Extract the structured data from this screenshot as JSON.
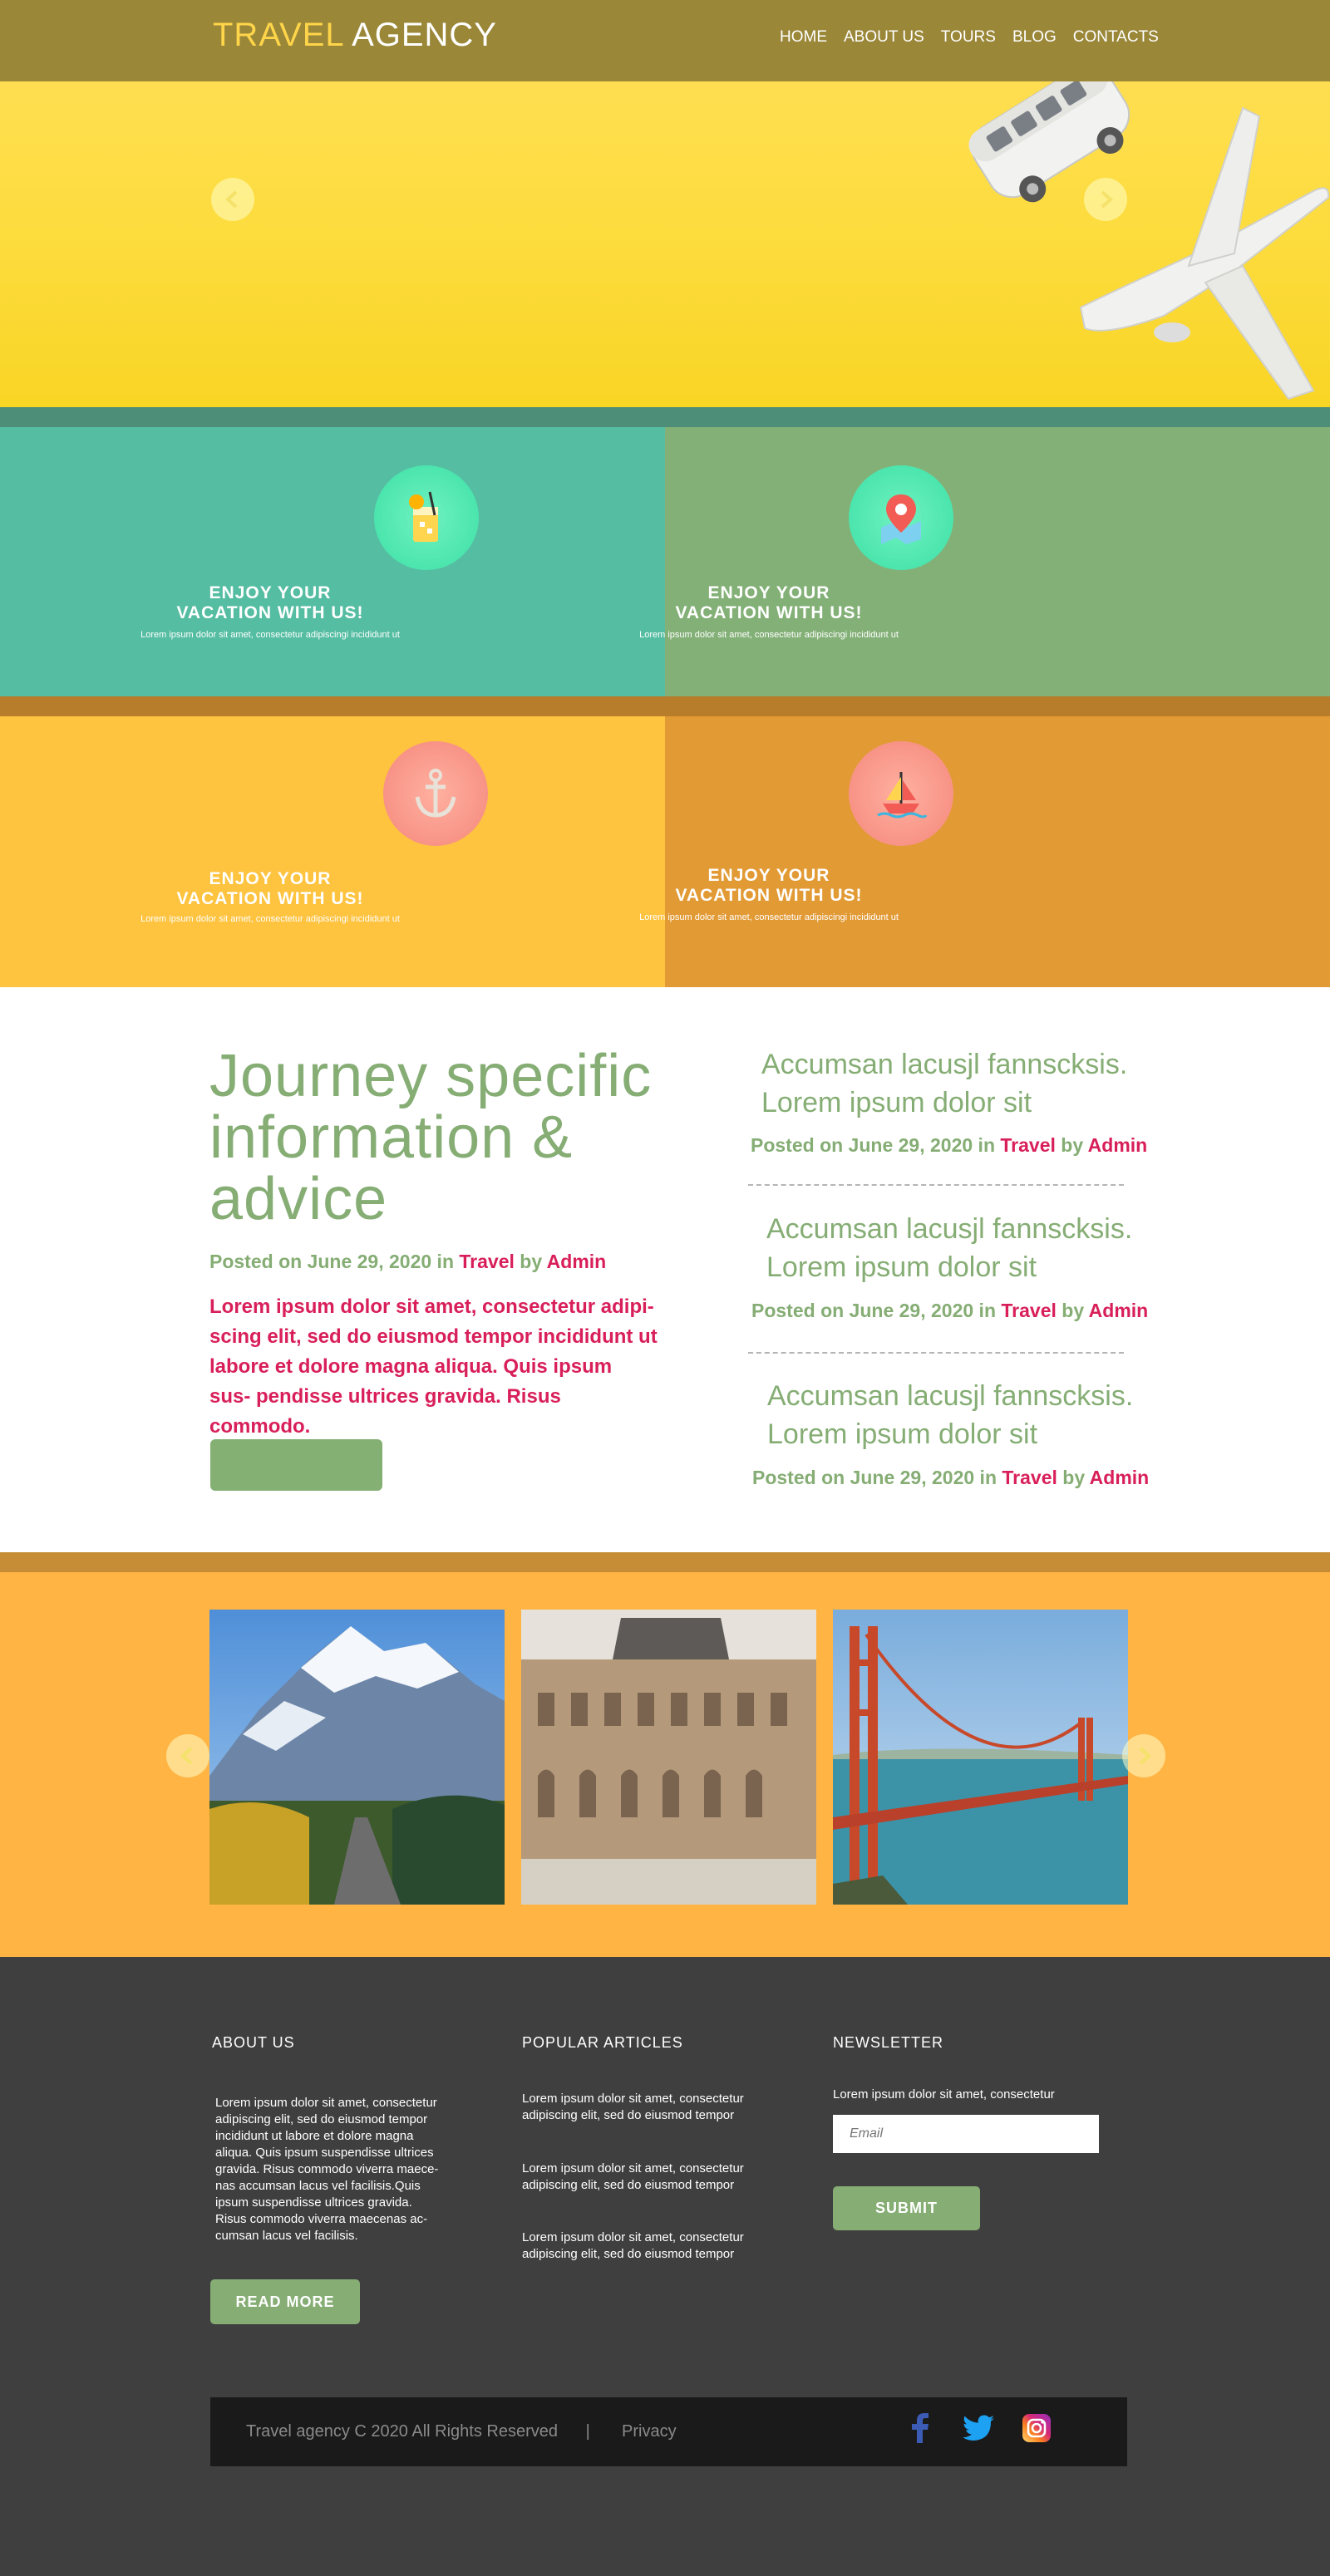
{
  "header": {
    "logo_part1": "TRAVEL",
    "logo_part2": "AGENCY",
    "nav": [
      "HOME",
      "ABOUT US",
      "TOURS",
      "BLOG",
      "CONTACTS"
    ]
  },
  "features": [
    {
      "title_line1": "ENJOY YOUR",
      "title_line2": "VACATION WITH US!",
      "text": "Lorem ipsum dolor sit amet, consectetur adipiscingi incididunt ut",
      "icon": "cocktail-icon",
      "bg": "#55bda2"
    },
    {
      "title_line1": "ENJOY YOUR",
      "title_line2": "VACATION WITH US!",
      "text": "Lorem ipsum dolor sit amet, consectetur adipiscingi incididunt ut",
      "icon": "map-pin-icon",
      "bg": "#83b077"
    },
    {
      "title_line1": "ENJOY YOUR",
      "title_line2": "VACATION WITH US!",
      "text": "Lorem ipsum dolor sit amet, consectetur adipiscingi incididunt ut",
      "icon": "anchor-icon",
      "bg": "#fec33f"
    },
    {
      "title_line1": "ENJOY YOUR",
      "title_line2": "VACATION WITH US!",
      "text": "Lorem ipsum dolor sit amet, consectetur adipiscingi incididunt ut",
      "icon": "sailboat-icon",
      "bg": "#e29a35"
    }
  ],
  "journey": {
    "title": "Journey specific information & advice",
    "posted_prefix": "Posted on June 29, 2020 in ",
    "category": "Travel",
    "by": " by ",
    "author": "Admin",
    "text": "Lorem ipsum dolor sit amet, consectetur adipi- scing elit, sed do eiusmod tempor incididunt ut labore et dolore magna aliqua. Quis ipsum sus- pendisse ultrices gravida. Risus commodo."
  },
  "articles": [
    {
      "line1": "Accumsan lacusjl fannscksis.",
      "line2": "Lorem ipsum dolor sit",
      "posted_prefix": "Posted on June 29, 2020 in ",
      "category": "Travel",
      "by": " by ",
      "author": "Admin"
    },
    {
      "line1": "Accumsan lacusjl fannscksis.",
      "line2": "Lorem ipsum dolor sit",
      "posted_prefix": "Posted on June 29, 2020 in ",
      "category": "Travel",
      "by": " by ",
      "author": "Admin"
    },
    {
      "line1": "Accumsan lacusjl fannscksis.",
      "line2": "Lorem ipsum dolor sit",
      "posted_prefix": "Posted on June 29, 2020 in ",
      "category": "Travel",
      "by": " by ",
      "author": "Admin"
    }
  ],
  "gallery": {
    "photos": [
      "mountain-road-photo",
      "museum-building-photo",
      "golden-gate-bridge-photo"
    ]
  },
  "footer": {
    "about": {
      "heading": "ABOUT US",
      "text": "Lorem ipsum dolor sit amet, consectetur adipiscing elit, sed do eiusmod tempor incididunt ut labore et dolore magna aliqua. Quis ipsum suspendisse ultrices gravida. Risus commodo viverra maece- nas accumsan lacus vel facilisis.Quis ipsum suspendisse ultrices gravida. Risus commodo viverra maecenas ac- cumsan lacus vel facilisis.",
      "button": "READ MORE"
    },
    "popular": {
      "heading": "POPULAR ARTICLES",
      "items": [
        "Lorem ipsum dolor sit amet, consectetur adipiscing elit, sed do eiusmod tempor",
        "Lorem ipsum dolor sit amet, consectetur adipiscing elit, sed do eiusmod tempor",
        "Lorem ipsum dolor sit amet, consectetur adipiscing elit, sed do eiusmod tempor"
      ]
    },
    "newsletter": {
      "heading": "NEWSLETTER",
      "text": "Lorem ipsum dolor sit amet, consectetur",
      "placeholder": "Email",
      "button": "SUBMIT"
    },
    "copyright": "Travel agency C 2020 All Rights Reserved",
    "separator": "|",
    "privacy": "Privacy",
    "social": [
      "facebook-icon",
      "twitter-icon",
      "instagram-icon"
    ]
  }
}
